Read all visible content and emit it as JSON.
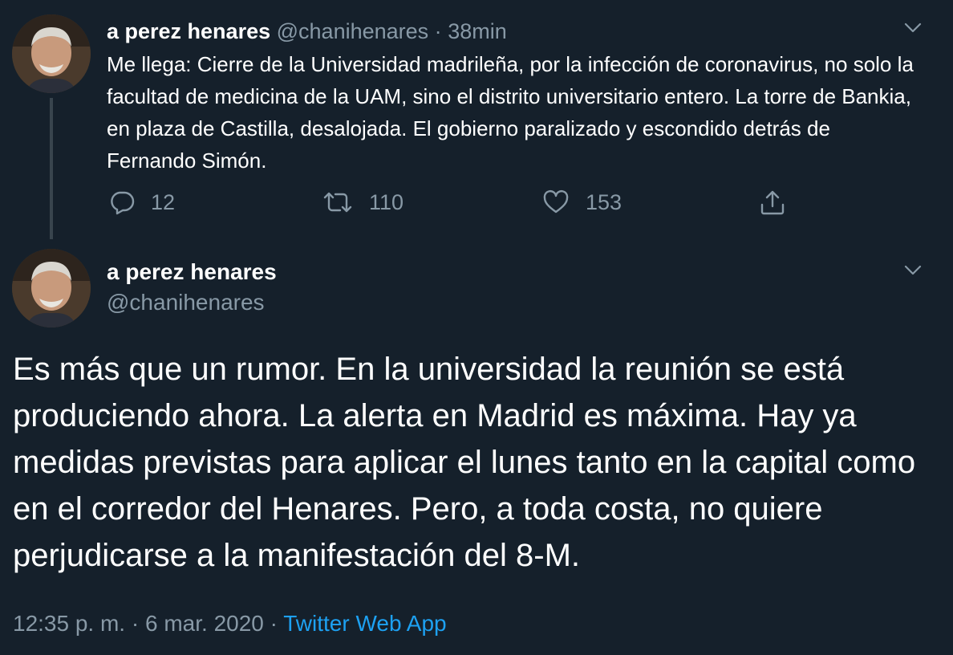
{
  "tweet1": {
    "name": "a perez henares",
    "handle": "@chanihenares",
    "separator": "·",
    "time": "38min",
    "text": "Me llega: Cierre de la Universidad madrileña, por la infección de coronavirus, no solo la facultad de medicina de la UAM, sino el distrito universitario entero. La torre de Bankia, en plaza de Castilla, desalojada. El gobierno paralizado y escondido detrás de Fernando Simón.",
    "actions": {
      "reply_count": "12",
      "retweet_count": "110",
      "like_count": "153"
    }
  },
  "tweet2": {
    "name": "a perez henares",
    "handle": "@chanihenares",
    "text": "Es más que un rumor. En la universidad la reunión se está produciendo ahora. La alerta en Madrid es máxima. Hay ya medidas previstas para aplicar el lunes tanto en la capital como en el corredor del Henares. Pero, a toda costa, no quiere perjudicarse a la manifestación del 8-M.",
    "time": "12:35 p. m.",
    "separator1": "·",
    "date": "6 mar. 2020",
    "separator2": "·",
    "source": "Twitter Web App"
  },
  "icons": {
    "reply": "reply-icon",
    "retweet": "retweet-icon",
    "like": "heart-icon",
    "share": "share-icon",
    "menu": "chevron-down-icon"
  },
  "colors": {
    "background": "#15202b",
    "text": "#ffffff",
    "muted": "#8899a6",
    "link": "#1da1f2",
    "thread_line": "#38444d"
  }
}
